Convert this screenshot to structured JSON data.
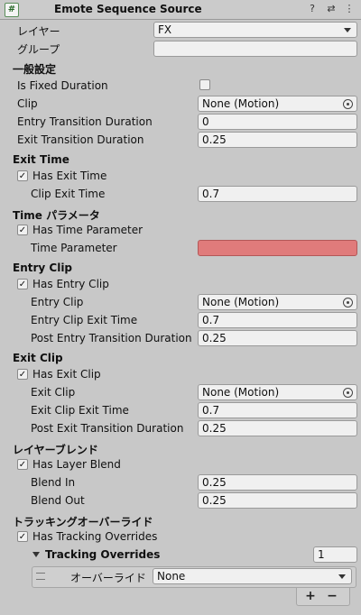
{
  "header": {
    "icon": "#",
    "title": "Emote Sequence Source",
    "help_icon": "?",
    "settings_icon": "⇄",
    "menu_icon": "⋮"
  },
  "top": {
    "layer_label": "レイヤー",
    "layer_value": "FX",
    "group_label": "グループ",
    "group_value": ""
  },
  "general": {
    "heading": "一般設定",
    "is_fixed_duration_label": "Is Fixed Duration",
    "clip_label": "Clip",
    "clip_value": "None (Motion)",
    "entry_transition_label": "Entry Transition Duration",
    "entry_transition_value": "0",
    "exit_transition_label": "Exit Transition Duration",
    "exit_transition_value": "0.25"
  },
  "exit_time": {
    "heading": "Exit Time",
    "has_exit_time_label": "Has Exit Time",
    "clip_exit_time_label": "Clip Exit Time",
    "clip_exit_time_value": "0.7"
  },
  "time_param": {
    "heading": "Time パラメータ",
    "has_time_parameter_label": "Has Time Parameter",
    "time_parameter_label": "Time Parameter",
    "time_parameter_value": ""
  },
  "entry_clip": {
    "heading": "Entry Clip",
    "has_entry_clip_label": "Has Entry Clip",
    "entry_clip_label": "Entry Clip",
    "entry_clip_value": "None (Motion)",
    "entry_clip_exit_time_label": "Entry Clip Exit Time",
    "entry_clip_exit_time_value": "0.7",
    "post_entry_label": "Post Entry Transition Duration",
    "post_entry_value": "0.25"
  },
  "exit_clip": {
    "heading": "Exit Clip",
    "has_exit_clip_label": "Has Exit Clip",
    "exit_clip_label": "Exit Clip",
    "exit_clip_value": "None (Motion)",
    "exit_clip_exit_time_label": "Exit Clip Exit Time",
    "exit_clip_exit_time_value": "0.7",
    "post_exit_label": "Post Exit Transition Duration",
    "post_exit_value": "0.25"
  },
  "layer_blend": {
    "heading": "レイヤーブレンド",
    "has_layer_blend_label": "Has Layer Blend",
    "blend_in_label": "Blend In",
    "blend_in_value": "0.25",
    "blend_out_label": "Blend Out",
    "blend_out_value": "0.25"
  },
  "tracking": {
    "heading": "トラッキングオーバーライド",
    "has_tracking_label": "Has Tracking Overrides",
    "list_label": "Tracking Overrides",
    "list_count": "1",
    "item_label": "オーバーライド",
    "item_value": "None",
    "add_button": "+",
    "remove_button": "−"
  },
  "checks": {
    "checked_glyph": "✓"
  },
  "colors": {
    "background": "#c8c8c8",
    "field_background": "#f0f0f0",
    "error_field": "#e07b7b"
  }
}
